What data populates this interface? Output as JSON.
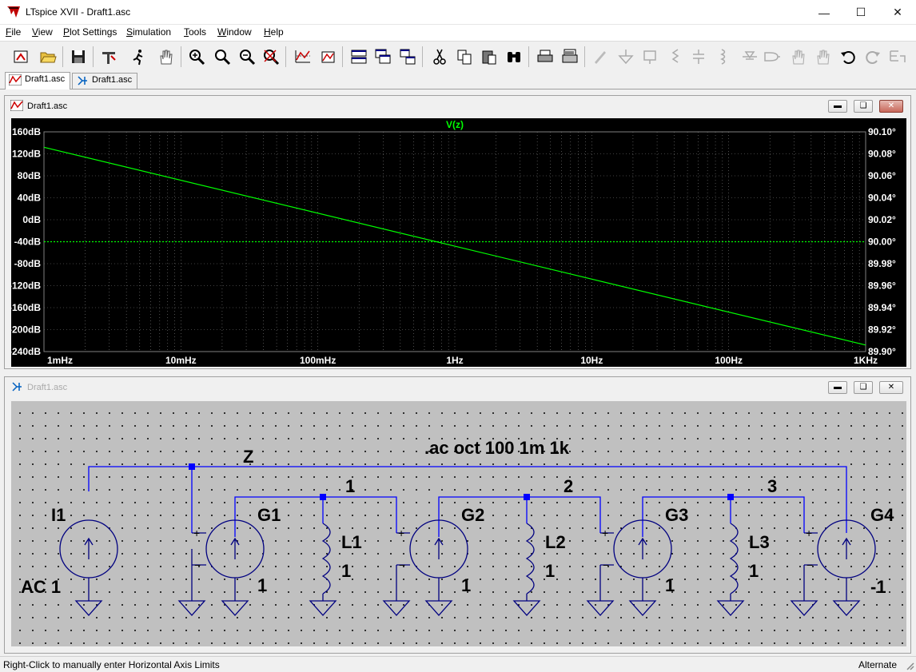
{
  "window": {
    "title": "LTspice XVII - Draft1.asc"
  },
  "menu": [
    {
      "label": "File",
      "key": "F",
      "rest": "ile"
    },
    {
      "label": "View",
      "key": "V",
      "rest": "iew"
    },
    {
      "label": "Plot Settings",
      "key": "P",
      "rest": "lot Settings"
    },
    {
      "label": "Simulation",
      "key": "S",
      "rest": "imulation"
    },
    {
      "label": "Tools",
      "key": "T",
      "rest": "ools"
    },
    {
      "label": "Window",
      "key": "W",
      "rest": "indow"
    },
    {
      "label": "Help",
      "key": "H",
      "rest": "elp"
    }
  ],
  "tabs": [
    {
      "label": "Draft1.asc",
      "icon": "waveform-icon",
      "active": true
    },
    {
      "label": "Draft1.asc",
      "icon": "schematic-icon",
      "active": false
    }
  ],
  "plot_window": {
    "title": "Draft1.asc"
  },
  "schematic_window": {
    "title": "Draft1.asc"
  },
  "chart_data": {
    "type": "line",
    "title": "V(z)",
    "x_scale": "log",
    "xlim": [
      0.001,
      1000
    ],
    "x_ticks": [
      {
        "value": 0.001,
        "label": "1mHz"
      },
      {
        "value": 0.01,
        "label": "10mHz"
      },
      {
        "value": 0.1,
        "label": "100mHz"
      },
      {
        "value": 1,
        "label": "1Hz"
      },
      {
        "value": 10,
        "label": "10Hz"
      },
      {
        "value": 100,
        "label": "100Hz"
      },
      {
        "value": 1000,
        "label": "1KHz"
      }
    ],
    "ylim_left": [
      -240,
      160
    ],
    "y_ticks_left": [
      "160dB",
      "120dB",
      "80dB",
      "40dB",
      "0dB",
      "-40dB",
      "-80dB",
      "-120dB",
      "-160dB",
      "-200dB",
      "-240dB"
    ],
    "ylim_right": [
      89.9,
      90.1
    ],
    "y_ticks_right": [
      "90.10°",
      "90.08°",
      "90.06°",
      "90.04°",
      "90.02°",
      "90.00°",
      "89.98°",
      "89.96°",
      "89.94°",
      "89.92°",
      "89.90°"
    ],
    "grid": true,
    "series": [
      {
        "name": "V(z)",
        "role": "magnitude",
        "axis": "left",
        "color": "#00ff00",
        "x": [
          0.001,
          1000
        ],
        "y": [
          132,
          -228
        ]
      },
      {
        "name": "V(z)",
        "role": "phase",
        "axis": "right",
        "color": "#00ff00",
        "style": "dotted",
        "x": [
          0.001,
          1000
        ],
        "y": [
          90.0,
          90.0
        ]
      }
    ]
  },
  "schematic": {
    "directive": ".ac oct 100 1m 1k",
    "nets": {
      "z": "Z",
      "n1": "1",
      "n2": "2",
      "n3": "3"
    },
    "components": [
      {
        "ref": "I1",
        "value": "AC 1"
      },
      {
        "ref": "G1",
        "value": "1"
      },
      {
        "ref": "L1",
        "value": "1"
      },
      {
        "ref": "G2",
        "value": "1"
      },
      {
        "ref": "L2",
        "value": "1"
      },
      {
        "ref": "G3",
        "value": "1"
      },
      {
        "ref": "L3",
        "value": "1"
      },
      {
        "ref": "G4",
        "value": "-1"
      }
    ]
  },
  "status": {
    "left": "Right-Click to manually enter Horizontal Axis Limits",
    "right": "Alternate"
  },
  "colors": {
    "trace": "#00ff00",
    "wire": "#0000ff",
    "schematic_bg": "#c0c0c0",
    "plot_bg": "#000000"
  }
}
